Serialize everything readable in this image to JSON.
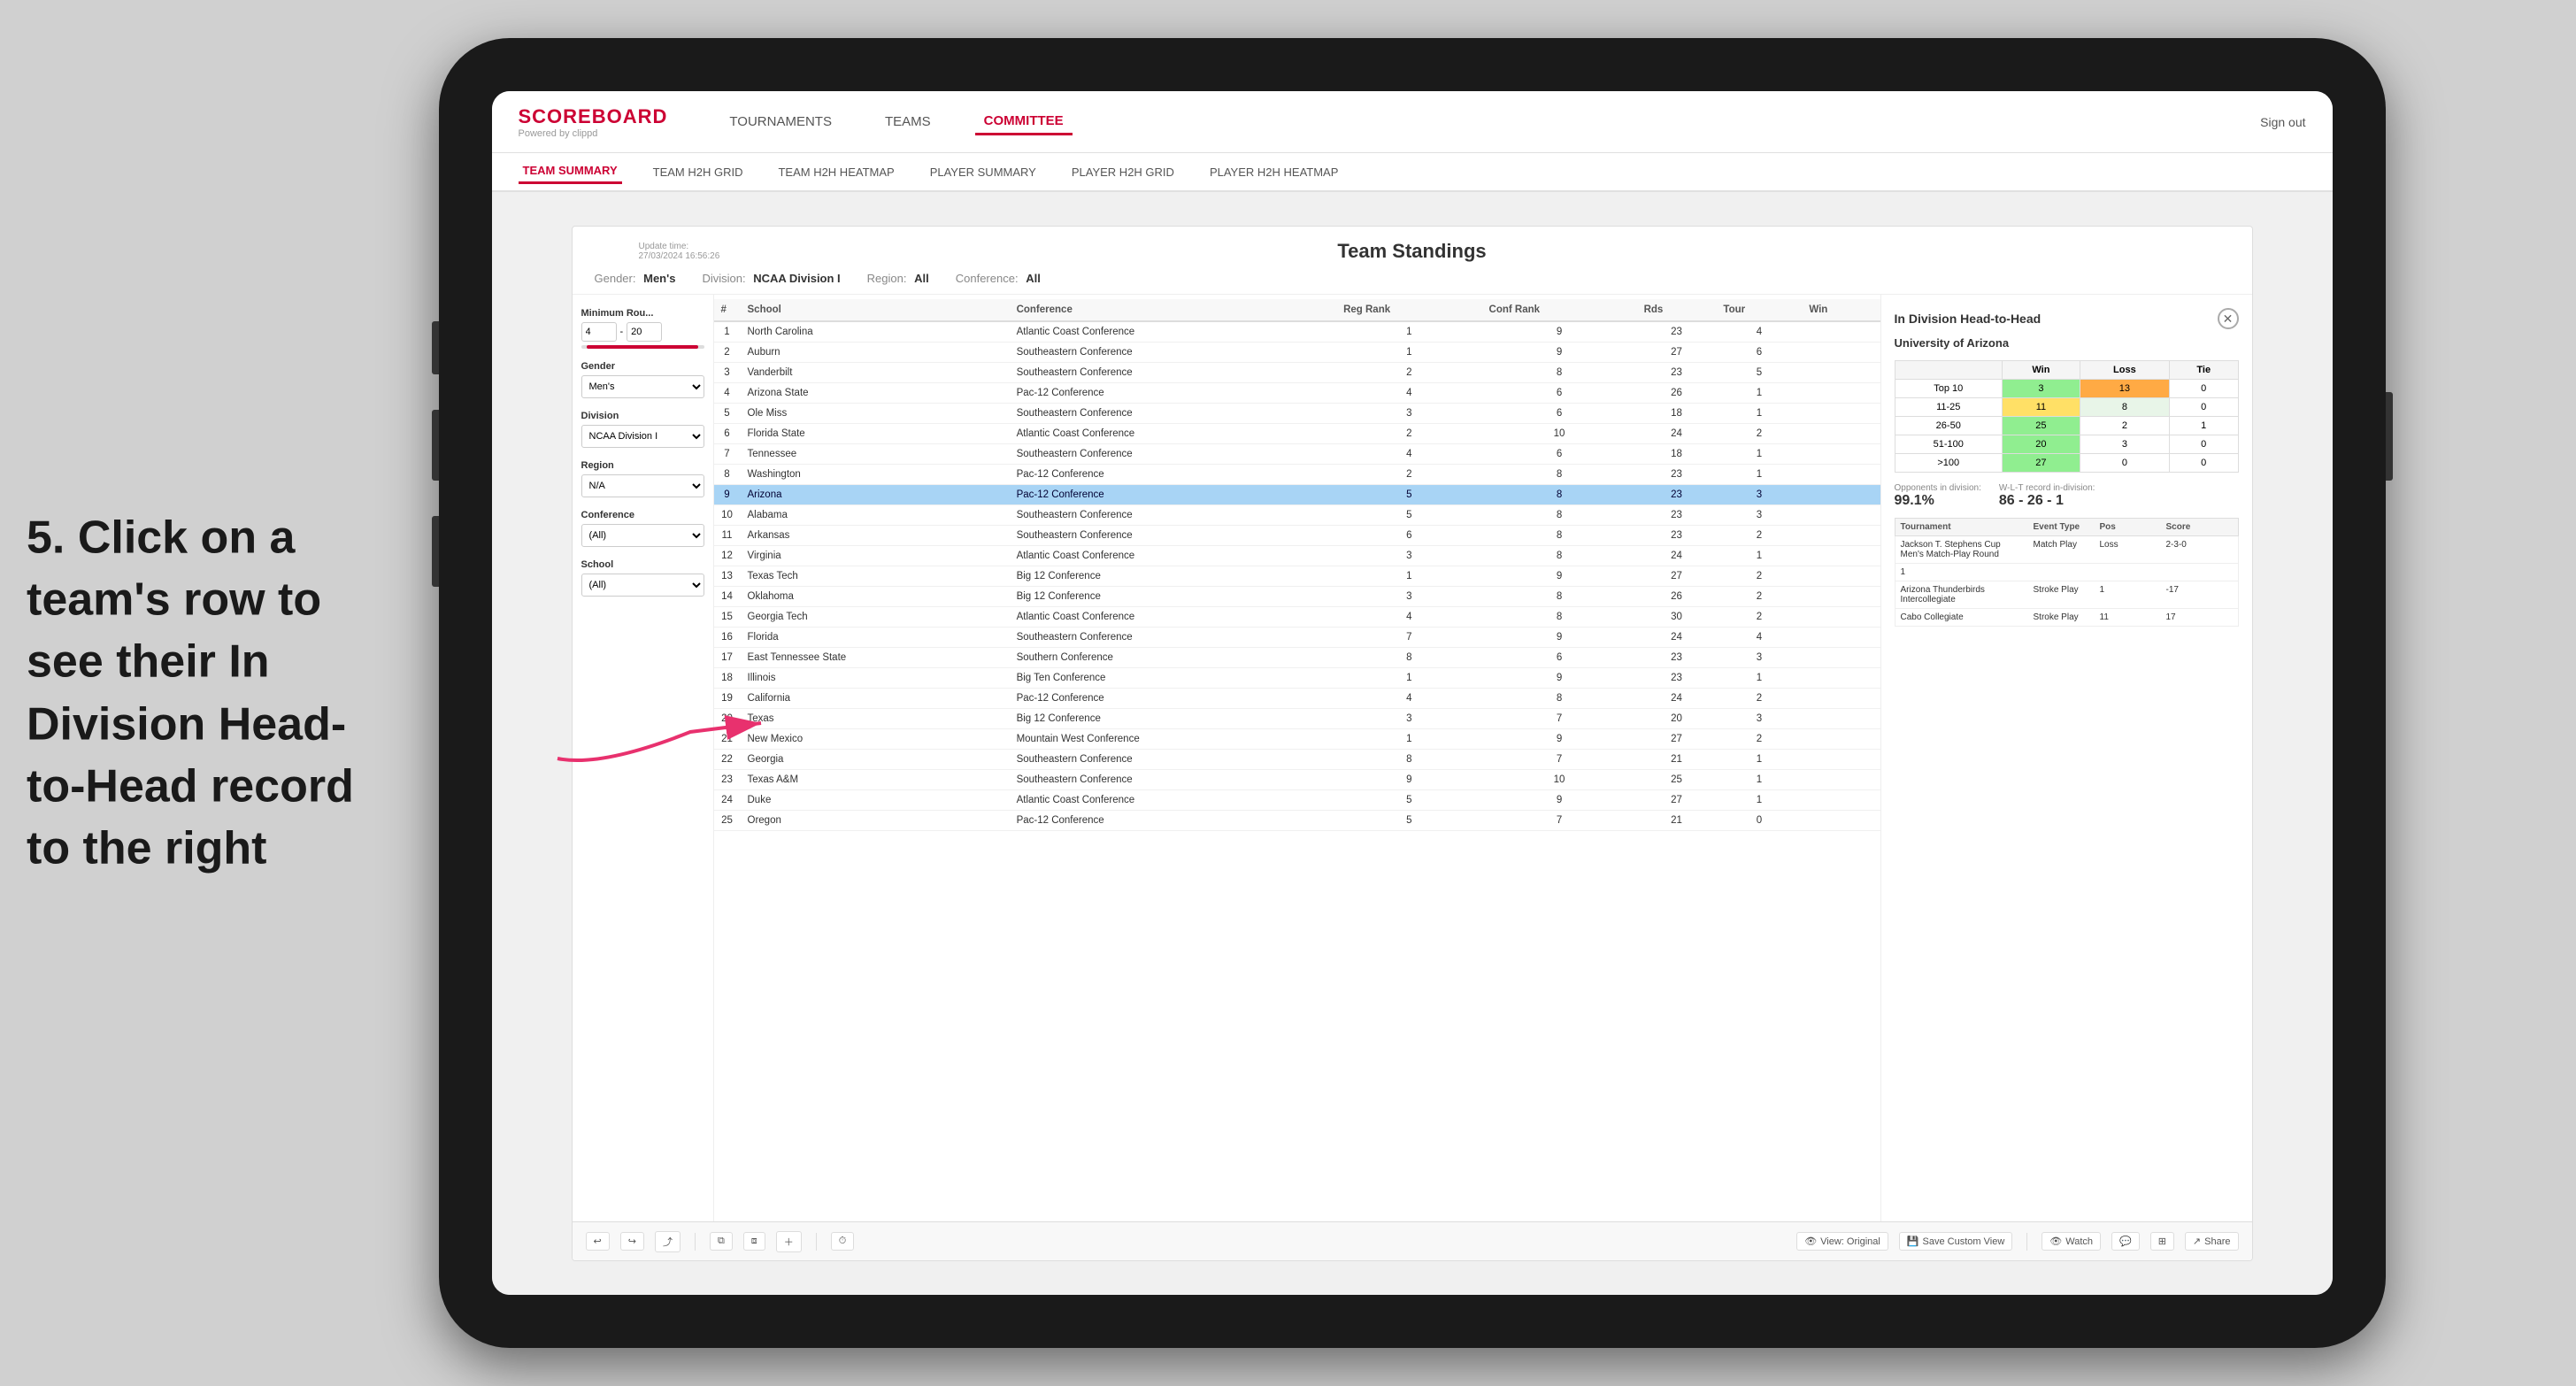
{
  "page": {
    "background": "#d0d0d0"
  },
  "annotation": {
    "text": "5. Click on a team's row to see their In Division Head-to-Head record to the right"
  },
  "app": {
    "logo": "SCOREBOARD",
    "logo_sub": "Powered by clippd",
    "sign_out": "Sign out",
    "nav": [
      {
        "label": "TOURNAMENTS",
        "active": false
      },
      {
        "label": "TEAMS",
        "active": false
      },
      {
        "label": "COMMITTEE",
        "active": true
      }
    ],
    "sub_nav": [
      {
        "label": "TEAM SUMMARY",
        "active": true
      },
      {
        "label": "TEAM H2H GRID",
        "active": false
      },
      {
        "label": "TEAM H2H HEATMAP",
        "active": false
      },
      {
        "label": "PLAYER SUMMARY",
        "active": false
      },
      {
        "label": "PLAYER H2H GRID",
        "active": false
      },
      {
        "label": "PLAYER H2H HEATMAP",
        "active": false
      }
    ]
  },
  "report": {
    "update_time_label": "Update time:",
    "update_time": "27/03/2024 16:56:26",
    "title": "Team Standings",
    "gender_label": "Gender:",
    "gender": "Men's",
    "division_label": "Division:",
    "division": "NCAA Division I",
    "region_label": "Region:",
    "region": "All",
    "conference_label": "Conference:",
    "conference": "All"
  },
  "filters": {
    "min_rounds_label": "Minimum Rou...",
    "min_rounds_from": "4",
    "min_rounds_to": "20",
    "gender_label": "Gender",
    "gender_value": "Men's",
    "division_label": "Division",
    "division_value": "NCAA Division I",
    "region_label": "Region",
    "region_value": "N/A",
    "conference_label": "Conference",
    "conference_value": "(All)",
    "school_label": "School",
    "school_value": "(All)"
  },
  "table": {
    "columns": [
      "#",
      "School",
      "Conference",
      "Reg Rank",
      "Conf Rank",
      "Rds",
      "Tour",
      "Win"
    ],
    "rows": [
      {
        "num": 1,
        "school": "North Carolina",
        "conference": "Atlantic Coast Conference",
        "reg_rank": 1,
        "conf_rank": 9,
        "rds": 23,
        "tour": 4,
        "win": ""
      },
      {
        "num": 2,
        "school": "Auburn",
        "conference": "Southeastern Conference",
        "reg_rank": 1,
        "conf_rank": 9,
        "rds": 27,
        "tour": 6,
        "win": ""
      },
      {
        "num": 3,
        "school": "Vanderbilt",
        "conference": "Southeastern Conference",
        "reg_rank": 2,
        "conf_rank": 8,
        "rds": 23,
        "tour": 5,
        "win": ""
      },
      {
        "num": 4,
        "school": "Arizona State",
        "conference": "Pac-12 Conference",
        "reg_rank": 4,
        "conf_rank": 6,
        "rds": 26,
        "tour": 1,
        "win": ""
      },
      {
        "num": 5,
        "school": "Ole Miss",
        "conference": "Southeastern Conference",
        "reg_rank": 3,
        "conf_rank": 6,
        "rds": 18,
        "tour": 1,
        "win": ""
      },
      {
        "num": 6,
        "school": "Florida State",
        "conference": "Atlantic Coast Conference",
        "reg_rank": 2,
        "conf_rank": 10,
        "rds": 24,
        "tour": 2,
        "win": ""
      },
      {
        "num": 7,
        "school": "Tennessee",
        "conference": "Southeastern Conference",
        "reg_rank": 4,
        "conf_rank": 6,
        "rds": 18,
        "tour": 1,
        "win": ""
      },
      {
        "num": 8,
        "school": "Washington",
        "conference": "Pac-12 Conference",
        "reg_rank": 2,
        "conf_rank": 8,
        "rds": 23,
        "tour": 1,
        "win": ""
      },
      {
        "num": 9,
        "school": "Arizona",
        "conference": "Pac-12 Conference",
        "reg_rank": 5,
        "conf_rank": 8,
        "rds": 23,
        "tour": 3,
        "win": "",
        "selected": true
      },
      {
        "num": 10,
        "school": "Alabama",
        "conference": "Southeastern Conference",
        "reg_rank": 5,
        "conf_rank": 8,
        "rds": 23,
        "tour": 3,
        "win": ""
      },
      {
        "num": 11,
        "school": "Arkansas",
        "conference": "Southeastern Conference",
        "reg_rank": 6,
        "conf_rank": 8,
        "rds": 23,
        "tour": 2,
        "win": ""
      },
      {
        "num": 12,
        "school": "Virginia",
        "conference": "Atlantic Coast Conference",
        "reg_rank": 3,
        "conf_rank": 8,
        "rds": 24,
        "tour": 1,
        "win": ""
      },
      {
        "num": 13,
        "school": "Texas Tech",
        "conference": "Big 12 Conference",
        "reg_rank": 1,
        "conf_rank": 9,
        "rds": 27,
        "tour": 2,
        "win": ""
      },
      {
        "num": 14,
        "school": "Oklahoma",
        "conference": "Big 12 Conference",
        "reg_rank": 3,
        "conf_rank": 8,
        "rds": 26,
        "tour": 2,
        "win": ""
      },
      {
        "num": 15,
        "school": "Georgia Tech",
        "conference": "Atlantic Coast Conference",
        "reg_rank": 4,
        "conf_rank": 8,
        "rds": 30,
        "tour": 2,
        "win": ""
      },
      {
        "num": 16,
        "school": "Florida",
        "conference": "Southeastern Conference",
        "reg_rank": 7,
        "conf_rank": 9,
        "rds": 24,
        "tour": 4,
        "win": ""
      },
      {
        "num": 17,
        "school": "East Tennessee State",
        "conference": "Southern Conference",
        "reg_rank": 8,
        "conf_rank": 6,
        "rds": 23,
        "tour": 3,
        "win": ""
      },
      {
        "num": 18,
        "school": "Illinois",
        "conference": "Big Ten Conference",
        "reg_rank": 1,
        "conf_rank": 9,
        "rds": 23,
        "tour": 1,
        "win": ""
      },
      {
        "num": 19,
        "school": "California",
        "conference": "Pac-12 Conference",
        "reg_rank": 4,
        "conf_rank": 8,
        "rds": 24,
        "tour": 2,
        "win": ""
      },
      {
        "num": 20,
        "school": "Texas",
        "conference": "Big 12 Conference",
        "reg_rank": 3,
        "conf_rank": 7,
        "rds": 20,
        "tour": 3,
        "win": ""
      },
      {
        "num": 21,
        "school": "New Mexico",
        "conference": "Mountain West Conference",
        "reg_rank": 1,
        "conf_rank": 9,
        "rds": 27,
        "tour": 2,
        "win": ""
      },
      {
        "num": 22,
        "school": "Georgia",
        "conference": "Southeastern Conference",
        "reg_rank": 8,
        "conf_rank": 7,
        "rds": 21,
        "tour": 1,
        "win": ""
      },
      {
        "num": 23,
        "school": "Texas A&M",
        "conference": "Southeastern Conference",
        "reg_rank": 9,
        "conf_rank": 10,
        "rds": 25,
        "tour": 1,
        "win": ""
      },
      {
        "num": 24,
        "school": "Duke",
        "conference": "Atlantic Coast Conference",
        "reg_rank": 5,
        "conf_rank": 9,
        "rds": 27,
        "tour": 1,
        "win": ""
      },
      {
        "num": 25,
        "school": "Oregon",
        "conference": "Pac-12 Conference",
        "reg_rank": 5,
        "conf_rank": 7,
        "rds": 21,
        "tour": 0,
        "win": ""
      }
    ]
  },
  "h2h_panel": {
    "title": "In Division Head-to-Head",
    "team_name": "University of Arizona",
    "grid": {
      "headers": [
        "",
        "Win",
        "Loss",
        "Tie"
      ],
      "rows": [
        {
          "label": "Top 10",
          "win": 3,
          "loss": 13,
          "tie": 0,
          "win_color": "green",
          "loss_color": "orange"
        },
        {
          "label": "11-25",
          "win": 11,
          "loss": 8,
          "tie": 0,
          "win_color": "yellow",
          "loss_color": "light"
        },
        {
          "label": "26-50",
          "win": 25,
          "loss": 2,
          "tie": 1,
          "win_color": "green2",
          "loss_color": "none"
        },
        {
          "label": "51-100",
          "win": 20,
          "loss": 3,
          "tie": 0,
          "win_color": "green2",
          "loss_color": "none"
        },
        {
          "label": ">100",
          "win": 27,
          "loss": 0,
          "tie": 0,
          "win_color": "green2",
          "loss_color": "none"
        }
      ]
    },
    "opponents_label": "Opponents in division:",
    "opponents_value": "99.1%",
    "wlt_label": "W-L-T record in-division:",
    "wlt_value": "86 - 26 - 1",
    "tournaments": {
      "header": [
        "Tournament",
        "Event Type",
        "Pos",
        "Score"
      ],
      "rows": [
        {
          "tournament": "Jackson T. Stephens Cup Men's Match-Play Round",
          "event_type": "Match Play",
          "pos": "Loss",
          "score": "2-3-0"
        },
        {
          "tournament": "1",
          "event_type": "",
          "pos": "",
          "score": ""
        },
        {
          "tournament": "Arizona Thunderbirds Intercollegiate",
          "event_type": "Stroke Play",
          "pos": "1",
          "score": "-17"
        },
        {
          "tournament": "Cabo Collegiate",
          "event_type": "Stroke Play",
          "pos": "11",
          "score": "17"
        }
      ]
    }
  },
  "toolbar": {
    "undo": "↩",
    "view_original": "View: Original",
    "save_custom_view": "Save Custom View",
    "watch": "Watch",
    "share": "Share"
  }
}
